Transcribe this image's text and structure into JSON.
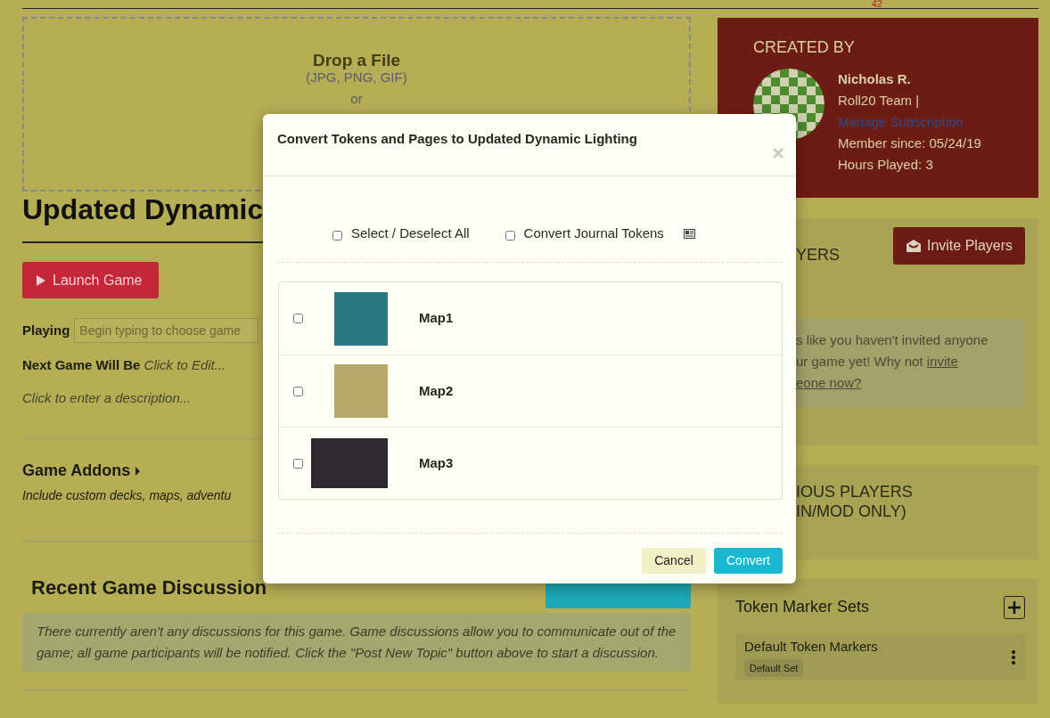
{
  "page_number": "42",
  "drop_zone": {
    "title": "Drop a File",
    "formats": "(JPG, PNG, GIF)",
    "or": "or"
  },
  "game": {
    "title": "Updated Dynamic",
    "launch_button": "Launch Game",
    "playing_label": "Playing",
    "playing_placeholder": "Begin typing to choose game",
    "next_label": "Next Game Will Be",
    "next_value": "Click to Edit...",
    "description": "Click to enter a description..."
  },
  "addons": {
    "title": "Game Addons",
    "text": "Include custom decks, maps, adventu"
  },
  "discussion": {
    "title": "Recent Game Discussion",
    "notice": "There currently aren't any discussions for this game. Game discussions allow you to communicate out of the game; all game participants will be notified. Click the \"Post New Topic\" button above to start a discussion."
  },
  "creator": {
    "heading": "CREATED BY",
    "name": "Nicholas R.",
    "team": "Roll20 Team |",
    "link": "Manage Subscription",
    "member_since": "Member since: 05/24/19",
    "hours": "Hours Played: 3"
  },
  "players": {
    "heading": "YERS",
    "invite_button": "Invite Players",
    "line_1": "s like you haven't invited anyone",
    "line_2": "ur game yet! Why not",
    "link_1": "invite",
    "link_2": "eone now?"
  },
  "previous_players": {
    "heading_lines": [
      "IOUS PLAYERS",
      "IN/MOD ONLY)"
    ]
  },
  "token_markers": {
    "title": "Token Marker Sets",
    "sets": [
      {
        "name": "Default Token Markers",
        "badge": "Default Set"
      }
    ]
  },
  "modal": {
    "title": "Convert Tokens and Pages to Updated Dynamic Lighting",
    "options": [
      {
        "label": "Select / Deselect All",
        "checked": false
      },
      {
        "label": "Convert Journal Tokens",
        "checked": false
      }
    ],
    "maps": [
      {
        "name": "Map1",
        "checked": false
      },
      {
        "name": "Map2",
        "checked": false
      },
      {
        "name": "Map3",
        "checked": false
      }
    ],
    "cancel": "Cancel",
    "convert": "Convert"
  }
}
